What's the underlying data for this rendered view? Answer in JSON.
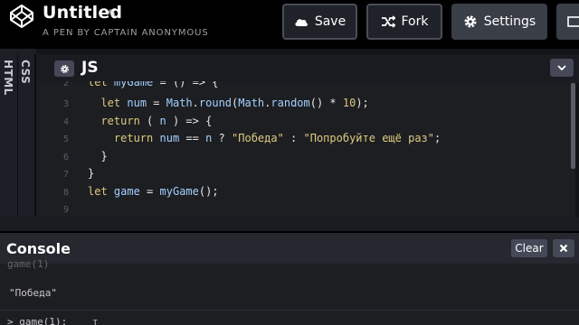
{
  "header": {
    "title": "Untitled",
    "subtitle": "A PEN BY CAPTAIN ANONYMOUS",
    "save_label": "Save",
    "fork_label": "Fork",
    "settings_label": "Settings"
  },
  "side_tabs": {
    "html": "HTML",
    "css": "CSS"
  },
  "editor": {
    "title": "JS",
    "lines": [
      {
        "n": "2",
        "text": "let myGame = () => {"
      },
      {
        "n": "3",
        "text": "  let num = Math.round(Math.random() * 10);"
      },
      {
        "n": "4",
        "text": "  return ( n ) => {"
      },
      {
        "n": "5",
        "text": "    return num == n ? \"Победа\" : \"Попробуйте ещё раз\";"
      },
      {
        "n": "6",
        "text": "  }"
      },
      {
        "n": "7",
        "text": "}"
      },
      {
        "n": "8",
        "text": "let game = myGame();"
      },
      {
        "n": "9",
        "text": ""
      }
    ]
  },
  "console": {
    "title": "Console",
    "clear_label": "Clear",
    "faded_line": "game(1)",
    "output": "\"Победа\"",
    "prompt": "> game(1);"
  },
  "colors": {
    "keyword": "#ddca7e",
    "identifier": "#a3d1ff",
    "background": "#1d1e22"
  }
}
